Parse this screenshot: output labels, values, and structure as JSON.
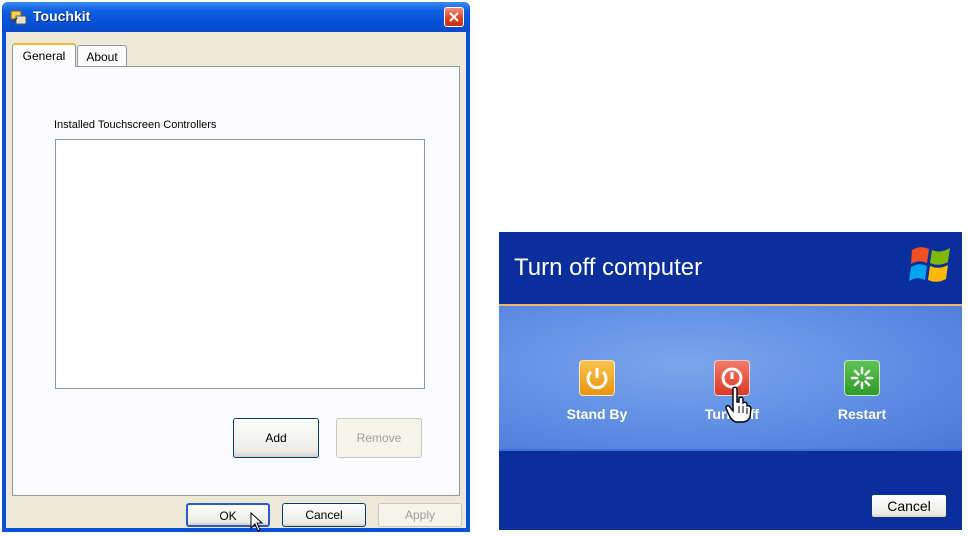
{
  "touchkit": {
    "title": "Touchkit",
    "tabs": [
      "General",
      "About"
    ],
    "group_label": "Installed Touchscreen Controllers",
    "buttons": {
      "add": "Add",
      "remove": "Remove",
      "ok": "OK",
      "cancel": "Cancel",
      "apply": "Apply"
    }
  },
  "turnoff": {
    "title": "Turn off computer",
    "options": [
      {
        "label": "Stand By",
        "color": "#f0a020"
      },
      {
        "label": "Turn Off",
        "color": "#e04a3a"
      },
      {
        "label": "Restart",
        "color": "#3fa83a"
      }
    ],
    "cancel": "Cancel"
  },
  "colors": {
    "xp_blue": "#0a2f9c",
    "xp_panel": "#6b93e6",
    "dialog_face": "#ece9d8"
  }
}
